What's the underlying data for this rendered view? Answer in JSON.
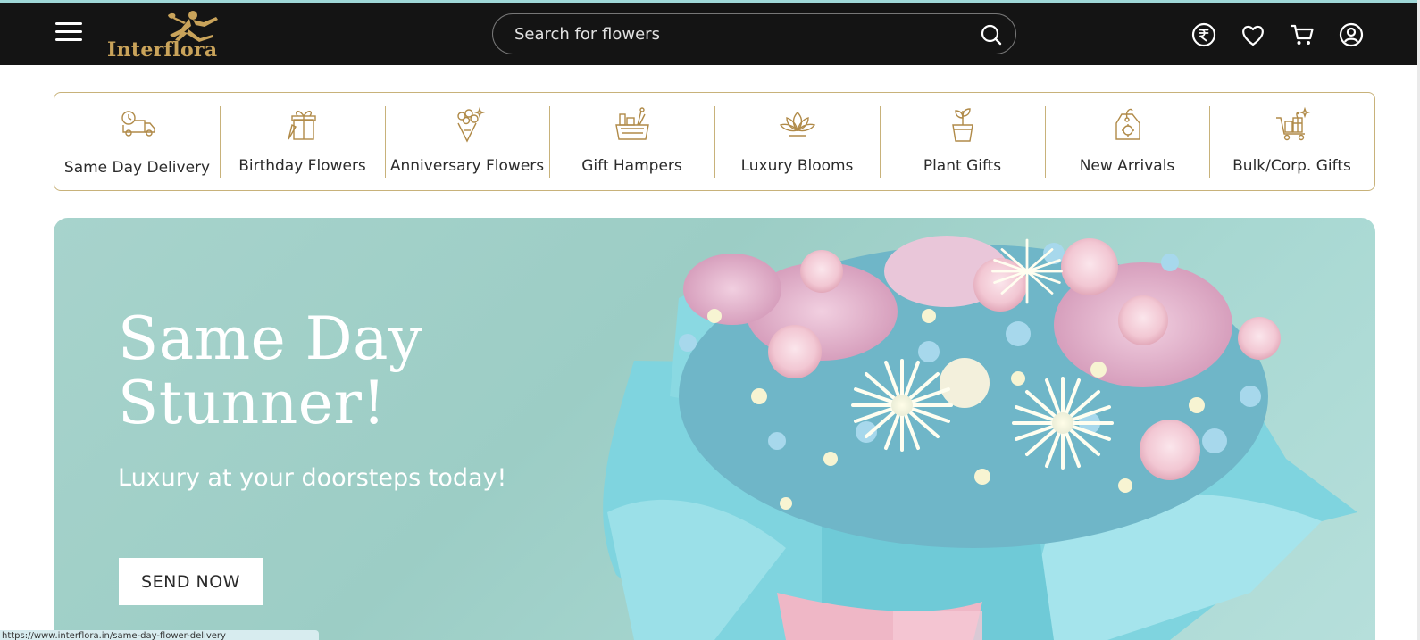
{
  "header": {
    "logo_text": "Interflora",
    "search_placeholder": "Search for flowers",
    "icons": [
      "menu-icon",
      "rupee-currency-icon",
      "heart-icon",
      "cart-icon",
      "user-account-icon"
    ]
  },
  "categories": [
    {
      "label": "Same Day Delivery",
      "icon": "delivery-truck-icon"
    },
    {
      "label": "Birthday Flowers",
      "icon": "gift-box-icon"
    },
    {
      "label": "Anniversary Flowers",
      "icon": "bouquet-icon"
    },
    {
      "label": "Gift Hampers",
      "icon": "hamper-basket-icon"
    },
    {
      "label": "Luxury Blooms",
      "icon": "lotus-icon"
    },
    {
      "label": "Plant Gifts",
      "icon": "potted-plant-icon"
    },
    {
      "label": "New Arrivals",
      "icon": "new-tag-icon"
    },
    {
      "label": "Bulk/Corp. Gifts",
      "icon": "gift-cart-icon"
    }
  ],
  "hero": {
    "title_line1": "Same Day",
    "title_line2": "Stunner!",
    "subtitle": "Luxury at your doorsteps today!",
    "button_label": "SEND NOW"
  },
  "status_url": "https://www.interflora.in/same-day-flower-delivery",
  "colors": {
    "header_bg": "#141414",
    "gold_accent": "#c9a35a",
    "category_border": "#c8b27a",
    "hero_bg": "#a7d3cc"
  }
}
